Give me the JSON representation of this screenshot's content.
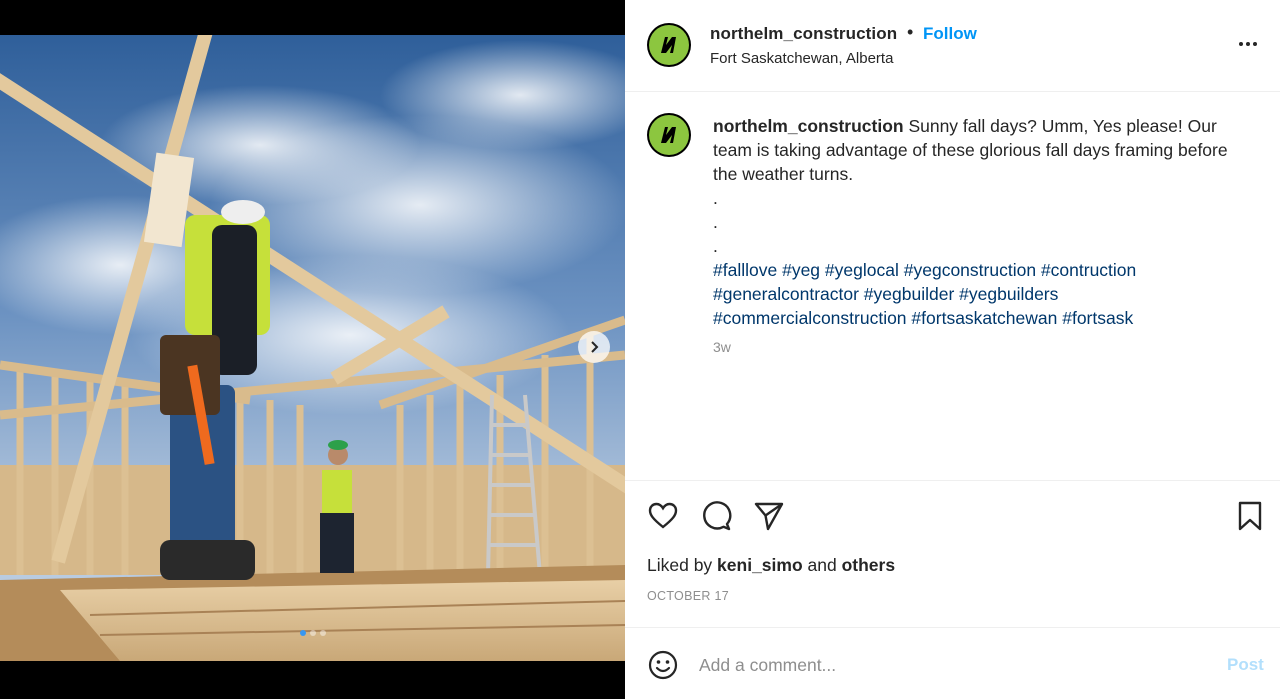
{
  "post": {
    "username": "northelm_construction",
    "separator": "•",
    "follow_label": "Follow",
    "location": "Fort Saskatchewan, Alberta",
    "more_icon": "more-horizontal-icon"
  },
  "caption": {
    "username": "northelm_construction",
    "text": " Sunny fall days? Umm, Yes please! Our team is taking advantage of these glorious fall days framing before the weather turns.",
    "dot_lines": [
      ".",
      ".",
      "."
    ],
    "hashtags": [
      "#falllove",
      "#yeg",
      "#yeglocal",
      "#yegconstruction",
      "#contruction",
      "#generalcontractor",
      "#yegbuilder",
      "#yegbuilders",
      "#commercialconstruction",
      "#fortsaskatchewan",
      "#fortsask"
    ],
    "age": "3w"
  },
  "engagement": {
    "liked_prefix": "Liked by ",
    "liked_user": "keni_simo",
    "liked_middle": " and ",
    "liked_others": "others",
    "date": "OCTOBER 17"
  },
  "actions": {
    "like_icon": "heart-icon",
    "comment_icon": "comment-icon",
    "share_icon": "send-icon",
    "save_icon": "bookmark-icon"
  },
  "comment": {
    "placeholder": "Add a comment...",
    "post_label": "Post"
  },
  "carousel": {
    "slide_count": 3,
    "active_index": 0
  },
  "colors": {
    "accent": "#0095f6",
    "brand_green": "#8cc63f",
    "hashtag": "#00376b",
    "muted": "#8e8e8e"
  }
}
